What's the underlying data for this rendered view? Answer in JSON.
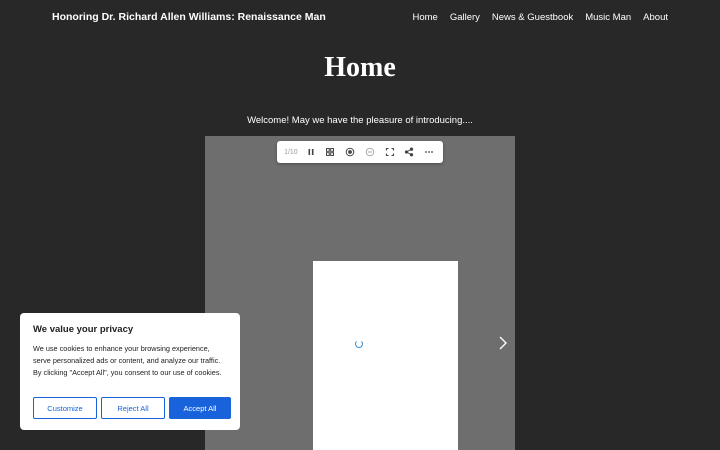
{
  "site": {
    "title": "Honoring Dr. Richard Allen Williams: Renaissance Man"
  },
  "nav": {
    "items": [
      "Home",
      "Gallery",
      "News & Guestbook",
      "Music Man",
      "About"
    ]
  },
  "page": {
    "title": "Home",
    "welcome": "Welcome! May we have the pleasure of introducing...."
  },
  "viewer": {
    "counter": "1/10",
    "toolbar_icons": [
      "pause-icon",
      "grid-icon",
      "zoom-in-icon",
      "zoom-out-icon",
      "fullscreen-icon",
      "share-icon",
      "more-icon"
    ]
  },
  "cookie": {
    "title": "We value your privacy",
    "body": "We use cookies to enhance your browsing experience, serve personalized ads or content, and analyze our traffic. By clicking \"Accept All\", you consent to our use of cookies.",
    "customize_label": "Customize",
    "reject_label": "Reject All",
    "accept_label": "Accept All"
  },
  "colors": {
    "background": "#282828",
    "viewer_bg": "#6e6e6e",
    "accent": "#1863dc"
  }
}
